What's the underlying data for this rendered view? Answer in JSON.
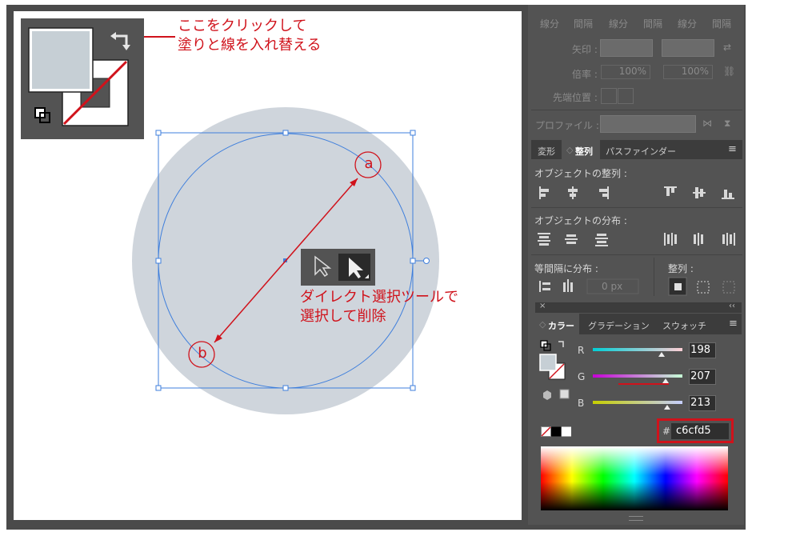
{
  "annotations": {
    "swap_line1": "ここをクリックして",
    "swap_line2": "塗りと線を入れ替える",
    "tool_line1": "ダイレクト選択ツールで",
    "tool_line2": "選択して削除",
    "point_a": "a",
    "point_b": "b"
  },
  "stroke_panel": {
    "col_headers": [
      "線分",
      "間隔",
      "線分",
      "間隔",
      "線分",
      "間隔"
    ],
    "arrow_label": "矢印 :",
    "scale_label": "倍率 :",
    "scale_value_1": "100%",
    "scale_value_2": "100%",
    "align_label": "先端位置 :",
    "profile_label": "プロファイル :"
  },
  "align_panel": {
    "tabs": [
      "変形",
      "整列",
      "パスファインダー"
    ],
    "active_tab": "整列",
    "object_align_label": "オブジェクトの整列 :",
    "object_distribute_label": "オブジェクトの分布 :",
    "spacing_label": "等間隔に分布 :",
    "spacing_value": "0 px",
    "align_to_label": "整列 :"
  },
  "color_panel": {
    "tabs": [
      "カラー",
      "グラデーション",
      "スウォッチ"
    ],
    "active_tab": "カラー",
    "r_label": "R",
    "g_label": "G",
    "b_label": "B",
    "r_value": "198",
    "g_value": "207",
    "b_value": "213",
    "hash": "#",
    "hex_value": "c6cfd5",
    "fill_color": "#c6cfd5"
  },
  "colors": {
    "annotation_red": "#d0121b",
    "selection_blue": "#3f7fdc",
    "shape_fill": "#cfd5dc"
  }
}
